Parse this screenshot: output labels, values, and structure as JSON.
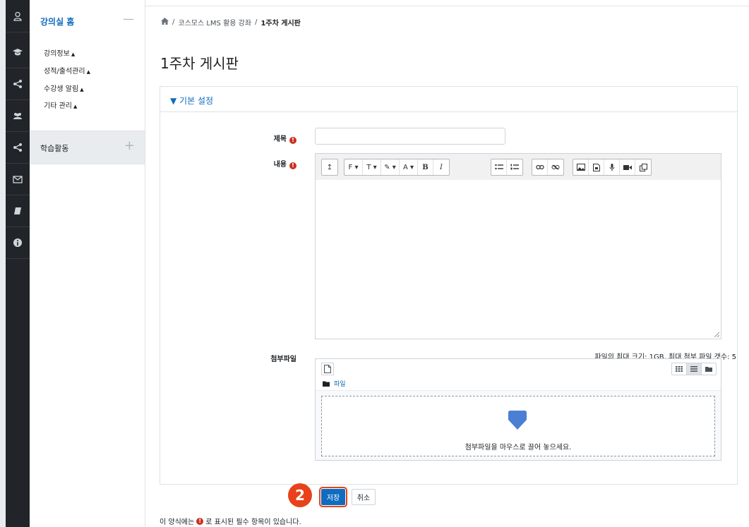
{
  "sidebar": {
    "home_label": "강의실 홈",
    "collapse_symbol": "—",
    "items": [
      {
        "label": "강의정보"
      },
      {
        "label": "성적/출석관리"
      },
      {
        "label": "수강생 알림"
      },
      {
        "label": "기타 관리"
      }
    ],
    "expand_glyph": "▲",
    "activity_label": "학습활동",
    "activity_expand": "+"
  },
  "iconbar": [
    "user-icon",
    "graduation-cap-icon",
    "share-icon",
    "users-icon",
    "share-icon",
    "envelope-icon",
    "book-icon",
    "info-icon"
  ],
  "breadcrumb": {
    "home_icon": "home-icon",
    "separator": "/",
    "course": "코스모스 LMS 활용 강좌",
    "current": "1주차 게시판"
  },
  "page_title": "1주차 게시판",
  "form": {
    "section_title": "▼ 기본 설정",
    "title_label": "제목",
    "content_label": "내용",
    "attach_label": "첨부파일",
    "required_mark": "!",
    "file_info": "파일의 최대 크기: 1GB, 최대 첨부 파일 갯수: 5",
    "folder_label": "파일",
    "drop_message": "첨부파일을 마우스로 끌어 놓으세요.",
    "title_value": ""
  },
  "toolbar": {
    "toggle": "↥",
    "font": "F ▾",
    "size": "T ▾",
    "color": "✎ ▾",
    "text_color": "A ▾",
    "bold": "B",
    "italic": "I"
  },
  "buttons": {
    "save": "저장",
    "cancel": "취소"
  },
  "step_marker": "2",
  "required_note": {
    "before": "이 양식에는",
    "after": "로 표시된 필수 항목이 있습니다."
  },
  "colors": {
    "accent": "#0f6cbf",
    "required": "#ca3120",
    "highlight": "#e8421a",
    "iconbar": "#212529"
  }
}
